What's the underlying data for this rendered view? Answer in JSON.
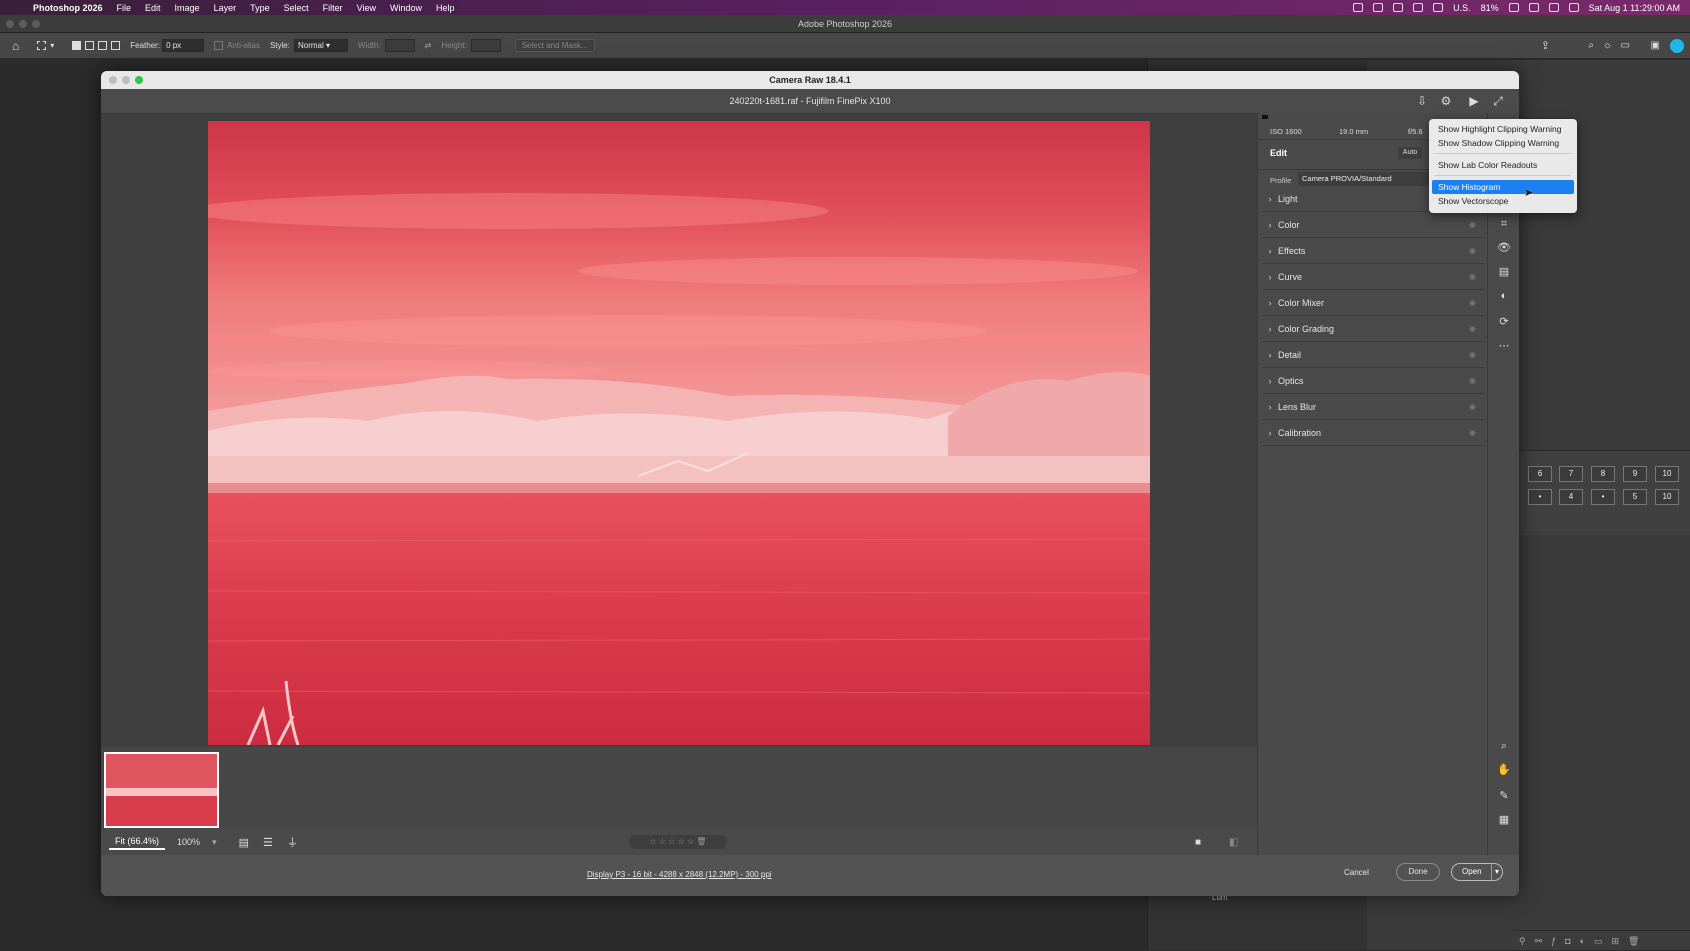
{
  "menubar": {
    "app_name": "Photoshop 2026",
    "items": [
      "File",
      "Edit",
      "Image",
      "Layer",
      "Type",
      "Select",
      "Filter",
      "View",
      "Window",
      "Help"
    ],
    "input_source": "U.S.",
    "battery": "81%",
    "datetime": "Sat Aug 1  11:29:00 AM"
  },
  "ps_window": {
    "title": "Adobe Photoshop 2026"
  },
  "options": {
    "feather_label": "Feather:",
    "feather_value": "0 px",
    "antialias_label": "Anti-alias",
    "style_label": "Style:",
    "style_value": "Normal",
    "width_label": "Width:",
    "height_label": "Height:",
    "select_mask_label": "Select and Mask..."
  },
  "ps_panels": {
    "grid_row1": [
      "6",
      "7",
      "8",
      "9",
      "10"
    ],
    "grid_row2": [
      "•",
      "4",
      "•",
      "5",
      "10"
    ],
    "lum_label": "Lum"
  },
  "dialog": {
    "title": "Camera Raw 18.4.1",
    "file_info": "240220t-1681.raf  -  Fujifilm FinePix X100",
    "exif": {
      "iso": "ISO 1600",
      "focal": "19.0 mm",
      "aperture": "f/5.6"
    },
    "edit_label": "Edit",
    "auto_label": "Auto",
    "profile_label": "Profile",
    "profile_value": "Camera PROVIA/Standard",
    "sections": [
      "Light",
      "Color",
      "Effects",
      "Curve",
      "Color Mixer",
      "Color Grading",
      "Detail",
      "Optics",
      "Lens Blur",
      "Calibration"
    ],
    "zoom_fit": "Fit (66.4%)",
    "zoom_100": "100%",
    "rating": "☆ ☆ ☆ ☆ ☆",
    "workflow_link": "Display P3 - 16 bit - 4288 x 2848 (12.2MP) - 300 ppi",
    "cancel_label": "Cancel",
    "done_label": "Done",
    "open_label": "Open"
  },
  "context_menu": {
    "items": [
      "Show Highlight Clipping Warning",
      "Show Shadow Clipping Warning",
      "Show Lab Color Readouts",
      "Show Histogram",
      "Show Vectorscope"
    ],
    "highlighted": "Show Histogram"
  },
  "colors": {
    "accent": "#1a7ff0",
    "photo_sky": "#e8505a",
    "photo_water": "#d73a48"
  }
}
